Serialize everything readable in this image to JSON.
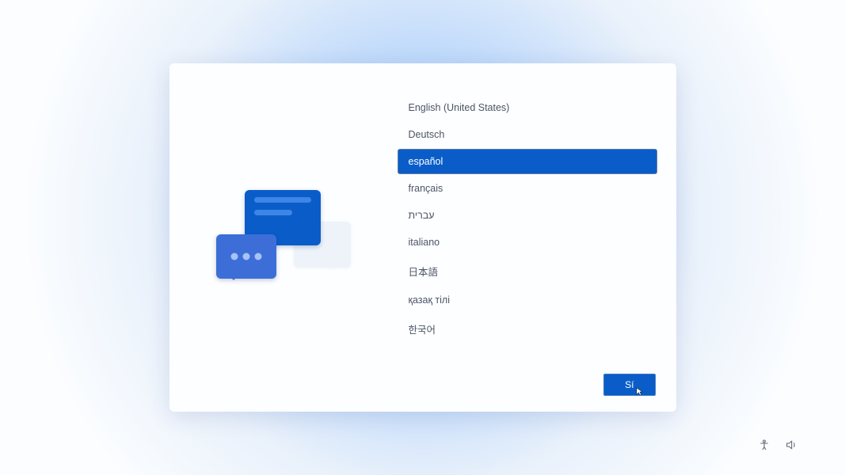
{
  "languages": [
    {
      "label": "English (United States)",
      "selected": false
    },
    {
      "label": "Deutsch",
      "selected": false
    },
    {
      "label": "español",
      "selected": true
    },
    {
      "label": "français",
      "selected": false
    },
    {
      "label": "עברית",
      "selected": false
    },
    {
      "label": "italiano",
      "selected": false
    },
    {
      "label": "日本語",
      "selected": false
    },
    {
      "label": "қазақ тілі",
      "selected": false
    },
    {
      "label": "한국어",
      "selected": false
    }
  ],
  "buttons": {
    "confirm": "Sí"
  }
}
